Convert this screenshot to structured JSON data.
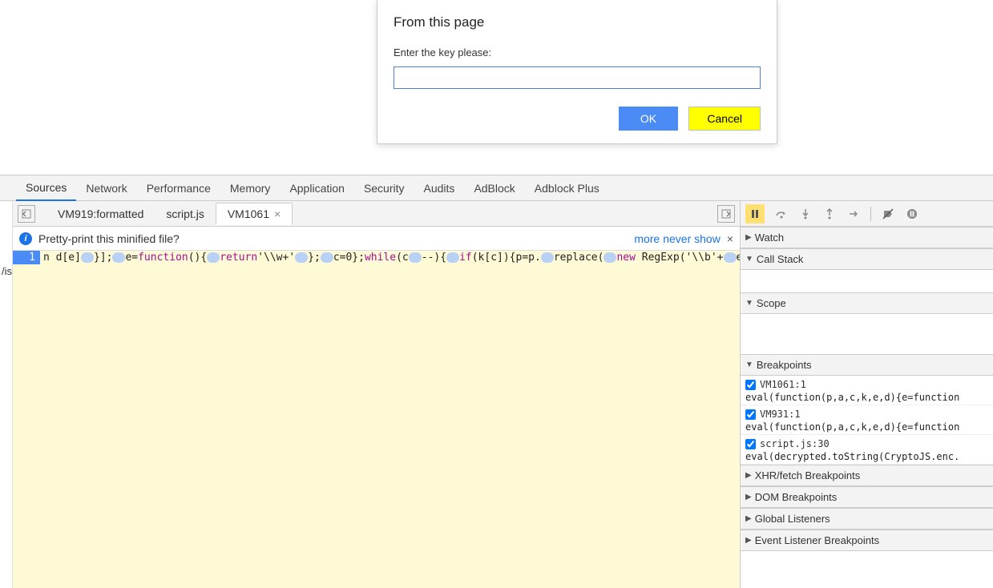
{
  "dialog": {
    "title": "From this page",
    "label": "Enter the key please:",
    "input_value": "",
    "ok_label": "OK",
    "cancel_label": "Cancel"
  },
  "devtools_tabs": {
    "items": [
      "Sources",
      "Network",
      "Performance",
      "Memory",
      "Application",
      "Security",
      "Audits",
      "AdBlock",
      "Adblock Plus"
    ],
    "active_index": 0
  },
  "file_tabs": {
    "items": [
      {
        "label": "VM919:formatted",
        "closable": false
      },
      {
        "label": "script.js",
        "closable": false
      },
      {
        "label": "VM1061",
        "closable": true
      }
    ],
    "active_index": 2
  },
  "notice": {
    "text": "Pretty-print this minified file?",
    "link_more": "more",
    "link_never": "never show"
  },
  "code": {
    "line_number": "1",
    "tokens": [
      "n d[e]",
      "pill",
      "}];",
      "pill",
      "e=",
      "kw:function",
      "(){",
      "pill",
      "kw:return",
      "'\\\\w+'",
      "pill",
      "};",
      "pill",
      "c=0};",
      "kw:while",
      "(c",
      "pill",
      "--){",
      "pill",
      "kw:if",
      "(k[c]){p=p.",
      "pill",
      "replace(",
      "pill",
      "kw:new",
      " RegExp('\\\\b'+",
      "pill",
      "e"
    ]
  },
  "left_file_list": "/is",
  "debug_toolbar": {
    "buttons": [
      "pause",
      "step-over",
      "step-into",
      "step-out",
      "step",
      "deactivate-bp",
      "pause-exceptions"
    ]
  },
  "sections": {
    "watch": {
      "label": "Watch",
      "expanded": false
    },
    "callstack": {
      "label": "Call Stack",
      "expanded": true
    },
    "scope": {
      "label": "Scope",
      "expanded": true
    },
    "breakpoints": {
      "label": "Breakpoints",
      "expanded": true,
      "items": [
        {
          "checked": true,
          "loc": "VM1061:1",
          "snippet": "eval(function(p,a,c,k,e,d){e=function"
        },
        {
          "checked": true,
          "loc": "VM931:1",
          "snippet": "eval(function(p,a,c,k,e,d){e=function"
        },
        {
          "checked": true,
          "loc": "script.js:30",
          "snippet": "eval(decrypted.toString(CryptoJS.enc."
        }
      ]
    },
    "xhr": {
      "label": "XHR/fetch Breakpoints",
      "expanded": false
    },
    "dom": {
      "label": "DOM Breakpoints",
      "expanded": false
    },
    "global": {
      "label": "Global Listeners",
      "expanded": false
    },
    "event": {
      "label": "Event Listener Breakpoints",
      "expanded": false
    }
  }
}
